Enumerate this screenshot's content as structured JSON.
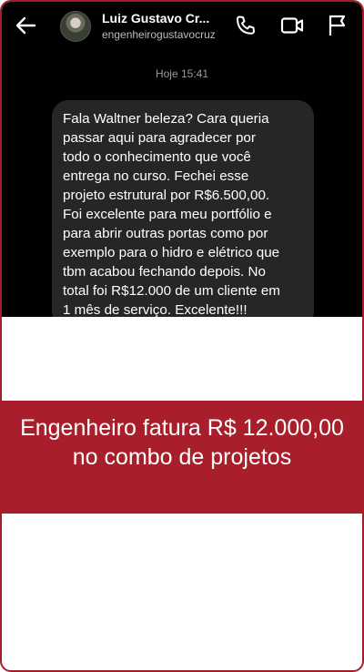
{
  "header": {
    "contact_name": "Luiz Gustavo Cr...",
    "contact_handle": "engenheirogustavocruz"
  },
  "icons": {
    "back": "arrow-left-icon",
    "call": "phone-icon",
    "video": "video-camera-icon",
    "report": "flag-icon"
  },
  "conversation": {
    "timestamp": "Hoje 15:41",
    "message": "Fala Waltner beleza? Cara queria\npassar aqui para agradecer por\ntodo o conhecimento que você\nentrega no curso. Fechei esse\nprojeto estrutural por R$6.500,00.\nFoi excelente para meu portfólio e\npara abrir outras portas como por\nexemplo para o hidro e elétrico que\ntbm acabou fechando depois. No\ntotal foi R$12.000 de um cliente em\n1 mês de serviço. Excelente!!!"
  },
  "banner": {
    "headline": "Engenheiro fatura R$ 12.000,00 no combo de projetos"
  },
  "colors": {
    "accent": "#a81e2b",
    "chat_background": "#000000",
    "bubble": "#262626"
  }
}
